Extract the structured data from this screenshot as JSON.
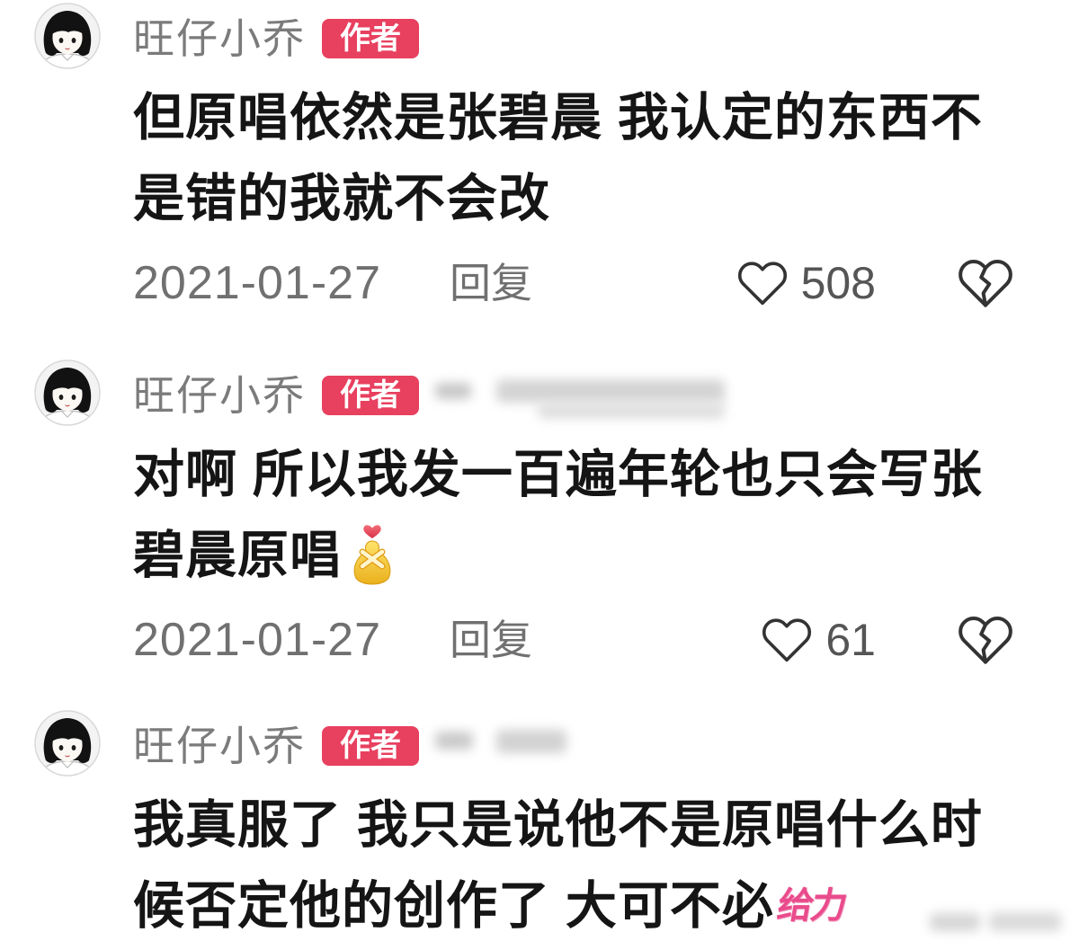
{
  "comments": [
    {
      "avatar_icon": "cartoon-girl-avatar",
      "username": "旺仔小乔",
      "badge": "作者",
      "lines": [
        "但原唱依然是张碧晨 我认定的东西不",
        "是错的我就不会改"
      ],
      "date": "2021-01-27",
      "reply_label": "回复",
      "like_icon": "heart-outline-icon",
      "like_count": 508,
      "dislike_icon": "broken-heart-icon"
    },
    {
      "avatar_icon": "cartoon-girl-avatar",
      "username": "旺仔小乔",
      "badge": "作者",
      "lines": [
        "对啊 所以我发一百遍年轮也只会写张",
        "碧晨原唱"
      ],
      "emoji_icon": "yellow-heart-hug-emoji",
      "date": "2021-01-27",
      "reply_label": "回复",
      "like_icon": "heart-outline-icon",
      "like_count": 61,
      "dislike_icon": "broken-heart-icon"
    },
    {
      "avatar_icon": "cartoon-girl-avatar",
      "username": "旺仔小乔",
      "badge": "作者",
      "lines": [
        "我真服了 我只是说他不是原唱什么时",
        "候否定他的创作了 大可不必"
      ],
      "sticker_text": "给力"
    }
  ],
  "colors": {
    "background": "#ffffff",
    "username": "#7b7b7b",
    "badge_background": "#e8405f",
    "badge_text": "#ffffff",
    "comment_text": "#151515",
    "meta_text": "#707070",
    "like_count": "#555555",
    "icon_stroke": "#333333",
    "sticker": "#e94b8c"
  }
}
